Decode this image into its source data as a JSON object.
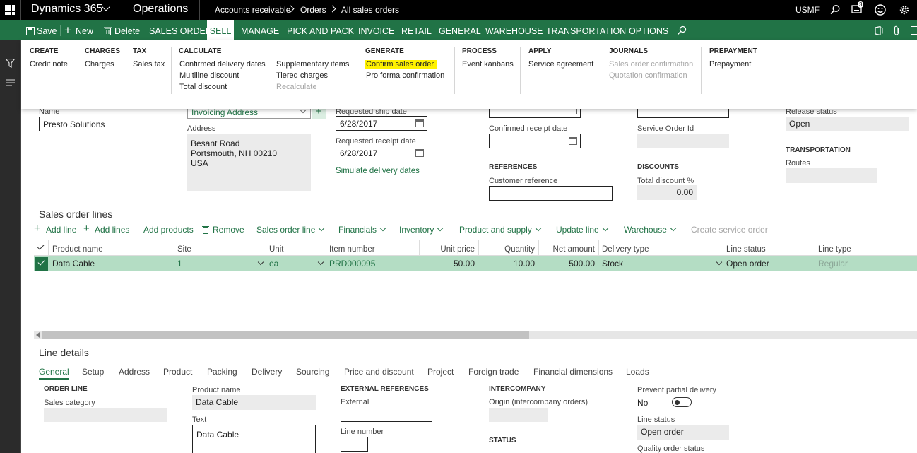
{
  "topnav": {
    "app_name": "Dynamics 365",
    "module": "Operations",
    "breadcrumb": [
      "Accounts receivable",
      "Orders",
      "All sales orders"
    ],
    "company": "USMF",
    "notification_count": "3"
  },
  "actionbar": {
    "save": "Save",
    "new": "New",
    "delete": "Delete",
    "tabs": [
      "SALES ORDER",
      "SELL",
      "MANAGE",
      "PICK AND PACK",
      "INVOICE",
      "RETAIL",
      "GENERAL",
      "WAREHOUSE",
      "TRANSPORTATION",
      "OPTIONS"
    ]
  },
  "ribbon": {
    "create": {
      "header": "CREATE",
      "items": [
        "Credit note"
      ]
    },
    "charges": {
      "header": "CHARGES",
      "items": [
        "Charges"
      ]
    },
    "tax": {
      "header": "TAX",
      "items": [
        "Sales tax"
      ]
    },
    "calculate": {
      "header": "CALCULATE",
      "items": [
        "Confirmed delivery dates",
        "Multiline discount",
        "Total discount",
        "Supplementary items",
        "Tiered charges",
        "Recalculate"
      ]
    },
    "generate": {
      "header": "GENERATE",
      "items": [
        "Confirm sales order",
        "Pro forma confirmation"
      ]
    },
    "process": {
      "header": "PROCESS",
      "items": [
        "Event kanbans"
      ]
    },
    "apply": {
      "header": "APPLY",
      "items": [
        "Service agreement"
      ]
    },
    "journals": {
      "header": "JOURNALS",
      "items": [
        "Sales order confirmation",
        "Quotation confirmation"
      ]
    },
    "prepayment": {
      "header": "PREPAYMENT",
      "items": [
        "Prepayment"
      ]
    }
  },
  "header": {
    "name_label": "Name",
    "name_value": "Presto Solutions",
    "address_select": "Invoicing Address",
    "address_label": "Address",
    "address_lines": [
      "Besant Road",
      "Portsmouth, NH 00210",
      "USA"
    ],
    "ship_label": "Requested ship date",
    "ship_value": "6/28/2017",
    "receipt_label": "Requested receipt date",
    "receipt_value": "6/28/2017",
    "simulate": "Simulate delivery dates",
    "confirmed_receipt_label": "Confirmed receipt date",
    "references_header": "REFERENCES",
    "customer_ref_label": "Customer reference",
    "service_order_label": "Service Order Id",
    "discounts_header": "DISCOUNTS",
    "total_discount_label": "Total discount %",
    "total_discount_value": "0.00",
    "release_status_label": "Release status",
    "release_status_value": "Open",
    "transportation_header": "TRANSPORTATION",
    "routes_label": "Routes"
  },
  "lines": {
    "title": "Sales order lines",
    "toolbar": [
      "Add line",
      "Add lines",
      "Add products",
      "Remove",
      "Sales order line",
      "Financials",
      "Inventory",
      "Product and supply",
      "Update line",
      "Warehouse",
      "Create service order"
    ],
    "columns": [
      "Product name",
      "Site",
      "Unit",
      "Item number",
      "Unit price",
      "Quantity",
      "Net amount",
      "Delivery type",
      "Line status",
      "Line type"
    ],
    "rows": [
      {
        "product": "Data Cable",
        "site": "1",
        "unit": "ea",
        "item": "PRD000095",
        "price": "50.00",
        "qty": "10.00",
        "amount": "500.00",
        "delivery": "Stock",
        "status": "Open order",
        "type": "Regular"
      }
    ]
  },
  "details": {
    "title": "Line details",
    "tabs": [
      "General",
      "Setup",
      "Address",
      "Product",
      "Packing",
      "Delivery",
      "Sourcing",
      "Price and discount",
      "Project",
      "Foreign trade",
      "Financial dimensions",
      "Loads"
    ],
    "order_line_header": "ORDER LINE",
    "sales_category_label": "Sales category",
    "product_name_label": "Product name",
    "product_name_value": "Data Cable",
    "text_label": "Text",
    "text_value": "Data Cable",
    "ext_ref_header": "EXTERNAL REFERENCES",
    "external_label": "External",
    "line_number_label": "Line number",
    "intercompany_header": "INTERCOMPANY",
    "origin_label": "Origin (intercompany orders)",
    "status_header": "STATUS",
    "prevent_label": "Prevent partial delivery",
    "prevent_value": "No",
    "line_status_label": "Line status",
    "line_status_value": "Open order",
    "quality_label": "Quality order status"
  },
  "colors": {
    "accent": "#217346",
    "selected_row": "#b4ddc4",
    "highlight": "#fff200"
  }
}
